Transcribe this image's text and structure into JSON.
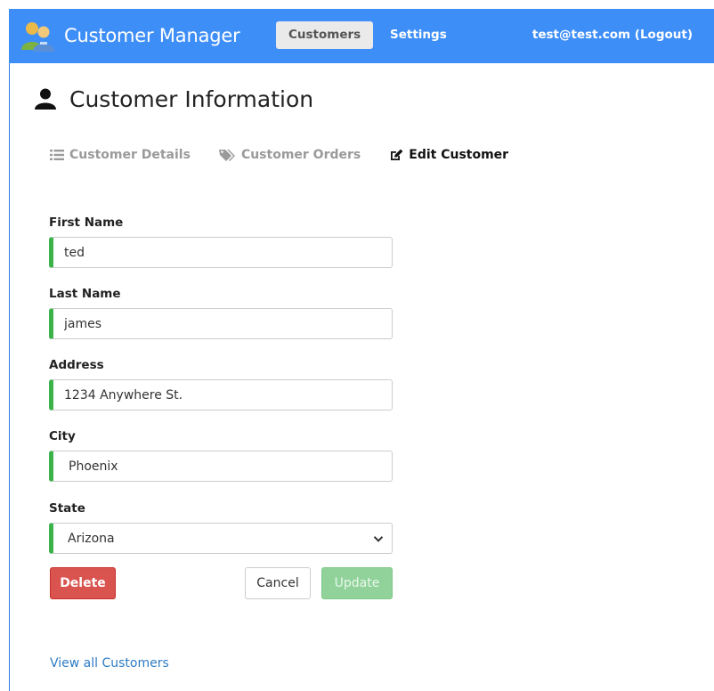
{
  "navbar": {
    "brand_title": "Customer Manager",
    "tabs": [
      {
        "label": "Customers",
        "active": true
      },
      {
        "label": "Settings",
        "active": false
      }
    ],
    "user_link": "test@test.com (Logout)",
    "bg_color": "#3e8ef7"
  },
  "header": {
    "icon": "user-icon",
    "title": "Customer Information"
  },
  "subtabs": [
    {
      "label": "Customer Details",
      "icon": "list-icon",
      "active": false
    },
    {
      "label": "Customer Orders",
      "icon": "tags-icon",
      "active": false
    },
    {
      "label": "Edit Customer",
      "icon": "edit-icon",
      "active": true
    }
  ],
  "form": {
    "first_name": {
      "label": "First Name",
      "value": "ted"
    },
    "last_name": {
      "label": "Last Name",
      "value": "james"
    },
    "address": {
      "label": "Address",
      "value": "1234 Anywhere St."
    },
    "city": {
      "label": "City",
      "value": "Phoenix"
    },
    "state": {
      "label": "State",
      "value": "Arizona"
    },
    "valid_color": "#3cb34a"
  },
  "buttons": {
    "delete": "Delete",
    "cancel": "Cancel",
    "update": "Update",
    "delete_color": "#d9534f",
    "update_color": "#90d299"
  },
  "footer": {
    "view_all_link": "View all Customers"
  }
}
